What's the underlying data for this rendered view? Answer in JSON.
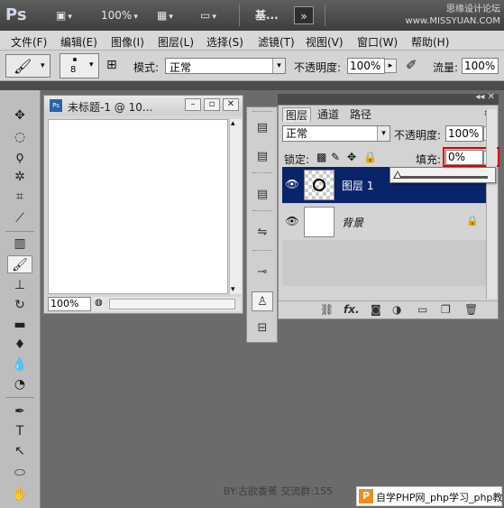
{
  "appbar": {
    "logo": "Ps",
    "zoom": "100%",
    "workspace": "基...",
    "overflow": "»",
    "watermark_line1": "思缘设计论坛",
    "watermark_line2": "www.MISSYUAN.COM"
  },
  "menu": [
    "文件(F)",
    "编辑(E)",
    "图像(I)",
    "图层(L)",
    "选择(S)",
    "滤镜(T)",
    "视图(V)",
    "窗口(W)",
    "帮助(H)"
  ],
  "options": {
    "brush_size": "8",
    "mode_label": "模式:",
    "mode_value": "正常",
    "opacity_label": "不透明度:",
    "opacity_value": "100%",
    "flow_label": "流量:",
    "flow_value": "100%"
  },
  "document": {
    "title": "未标题-1 @ 10...",
    "zoom": "100%"
  },
  "layers_panel": {
    "tabs": [
      "图层",
      "通道",
      "路径"
    ],
    "active_tab": "图层",
    "blend_mode": "正常",
    "opacity_label": "不透明度:",
    "opacity_value": "100%",
    "lock_label": "锁定:",
    "fill_label": "填充:",
    "fill_value": "0%",
    "fill_fraction": 0.0,
    "layers": [
      {
        "name": "图层 1",
        "selected": true,
        "transparent": true
      },
      {
        "name": "背景",
        "selected": false,
        "locked": true
      }
    ],
    "footer_icons": [
      "link-icon",
      "fx-icon",
      "mask-icon",
      "adjustment-icon",
      "group-icon",
      "new-layer-icon",
      "trash-icon"
    ]
  },
  "status": {
    "credits": "BY:古欲香蕉   交流群:155",
    "badge": "自学PHP网_php学习_php教"
  },
  "colors": {
    "selected_layer": "#0a246a",
    "highlight_red": "#e00000",
    "workspace_bg": "#6b6b6b"
  }
}
